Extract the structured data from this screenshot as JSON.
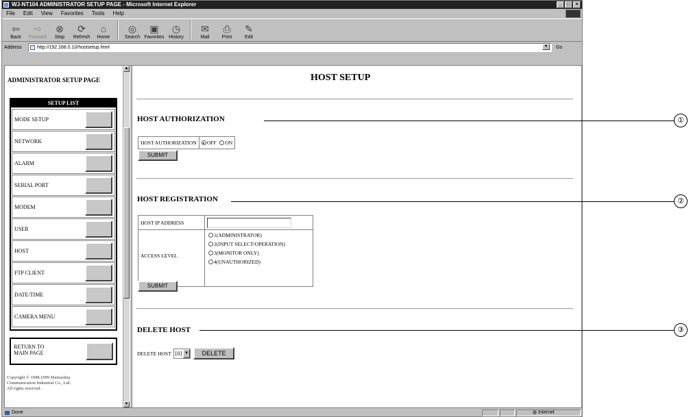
{
  "window": {
    "title": "WJ-NT104 ADMINISTRATOR SETUP PAGE - Microsoft Internet Explorer",
    "controls": [
      "_",
      "□",
      "×"
    ]
  },
  "menu": [
    "File",
    "Edit",
    "View",
    "Favorites",
    "Tools",
    "Help"
  ],
  "toolbar": [
    {
      "label": "Back",
      "icon": "back-arrow-icon",
      "glyph": "⇦",
      "disabled": false
    },
    {
      "label": "Forward",
      "icon": "forward-arrow-icon",
      "glyph": "⇨",
      "disabled": true
    },
    {
      "label": "Stop",
      "icon": "stop-icon",
      "glyph": "⊗",
      "disabled": false
    },
    {
      "label": "Refresh",
      "icon": "refresh-icon",
      "glyph": "⟳",
      "disabled": false
    },
    {
      "label": "Home",
      "icon": "home-icon",
      "glyph": "⌂",
      "disabled": false
    },
    {
      "label": "Search",
      "icon": "search-icon",
      "glyph": "◎",
      "disabled": false
    },
    {
      "label": "Favorites",
      "icon": "favorites-icon",
      "glyph": "▣",
      "disabled": false
    },
    {
      "label": "History",
      "icon": "history-icon",
      "glyph": "◷",
      "disabled": false
    },
    {
      "label": "Mail",
      "icon": "mail-icon",
      "glyph": "✉",
      "disabled": false
    },
    {
      "label": "Print",
      "icon": "print-icon",
      "glyph": "⎙",
      "disabled": false
    },
    {
      "label": "Edit",
      "icon": "edit-icon",
      "glyph": "✎",
      "disabled": false
    }
  ],
  "address": {
    "label": "Address",
    "url": "http://192.168.0.10/hostsetup.html",
    "go_label": "Go"
  },
  "sidebar": {
    "title": "ADMINISTRATOR SETUP PAGE",
    "list_title": "SETUP LIST",
    "items": [
      {
        "label": "MODE SETUP"
      },
      {
        "label": "NETWORK"
      },
      {
        "label": "ALARM"
      },
      {
        "label": "SERIAL PORT"
      },
      {
        "label": "MODEM"
      },
      {
        "label": "USER"
      },
      {
        "label": "HOST"
      },
      {
        "label": "FTP CLIENT"
      },
      {
        "label": "DATE/TIME"
      },
      {
        "label": "CAMERA MENU"
      }
    ],
    "return_label": "RETURN TO\nMAIN PAGE",
    "copyright": "Copyright © 1998,1999 Matsushita\nCommunication Industrial Co., Ltd.\nAll rights reserved."
  },
  "main": {
    "page_title": "HOST SETUP",
    "authorization": {
      "section_title": "HOST AUTHORIZATION",
      "field_label": "HOST AUTHORIZATION",
      "options": [
        {
          "label": "OFF",
          "checked": true
        },
        {
          "label": "ON",
          "checked": false
        }
      ],
      "submit_label": "SUBMIT"
    },
    "registration": {
      "section_title": "HOST REGISTRATION",
      "ip_label": "HOST IP ADDRESS",
      "ip_value": "",
      "access_label": "ACCESS LEVEL",
      "access_options": [
        "1(ADMINISTRATOR)",
        "2(INPUT SELECT/OPERATION)",
        "3(MONITOR ONLY)",
        "4(UNAUTHORIZED)"
      ],
      "submit_label": "SUBMIT"
    },
    "delete": {
      "section_title": "DELETE HOST",
      "field_label": "DELETE HOST",
      "selected": "[0]",
      "button_label": "DELETE"
    }
  },
  "status": {
    "left": "Done",
    "zone": "Internet"
  },
  "callouts": [
    "①",
    "②",
    "③"
  ]
}
